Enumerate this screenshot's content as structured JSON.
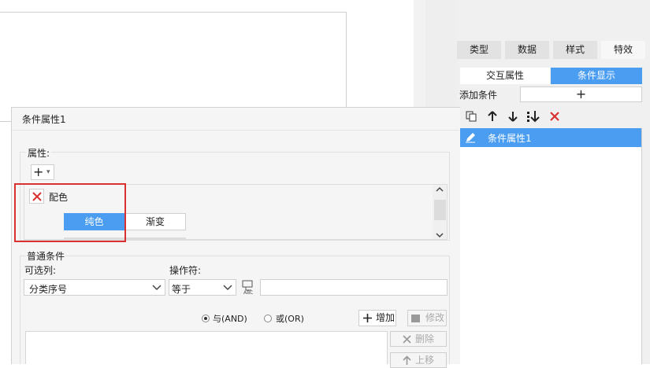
{
  "right_panel": {
    "tabs": [
      "类型",
      "数据",
      "样式",
      "特效"
    ],
    "active_tab": "特效",
    "subtabs": [
      "交互属性",
      "条件显示"
    ],
    "add_condition_label": "添加条件",
    "add_icon": "+",
    "list_items": [
      "条件属性1"
    ],
    "accent": "#4a9df0"
  },
  "dialog": {
    "title": "条件属性1",
    "attributes_label": "属性:",
    "add_button": "+",
    "attribute_item": "配色",
    "color_tabs": [
      "纯色",
      "渐变"
    ],
    "normal_condition_label": "普通条件",
    "selectable_label": "可选列:",
    "operator_label": "操作符:",
    "column_value": "分类序号",
    "operator_value": "等于",
    "value_input": "",
    "and_label": "与(AND)",
    "or_label": "或(OR)",
    "add_label": "增加",
    "modify_label": "修改",
    "delete_label": "删除",
    "move_up_label": "上移"
  },
  "colors": {
    "highlight_border": "#d93030",
    "delete_red": "#d93030"
  }
}
